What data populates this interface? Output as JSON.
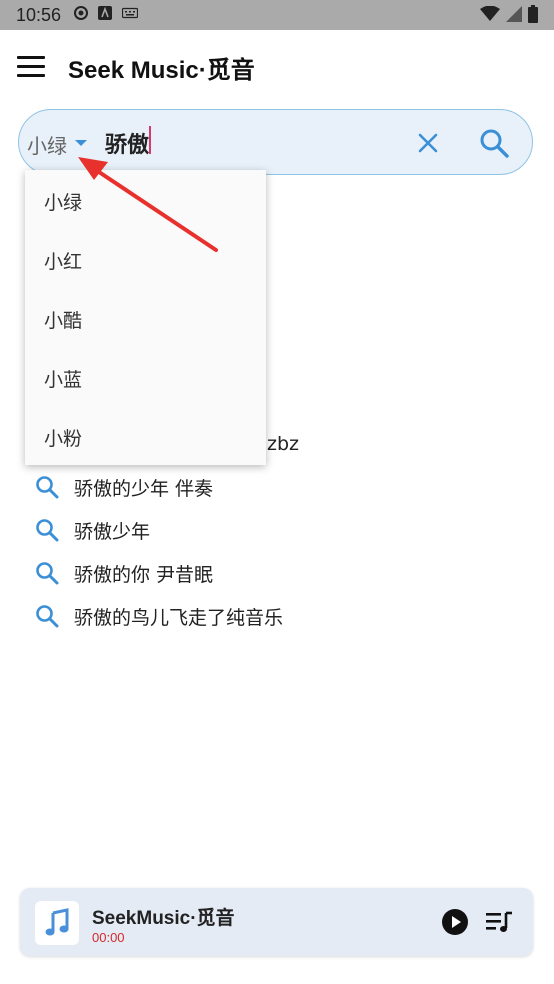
{
  "status_bar": {
    "time": "10:56"
  },
  "app_bar": {
    "title": "Seek Music·觅音"
  },
  "search": {
    "source": "小绿",
    "query": "骄傲"
  },
  "source_dropdown": {
    "items": [
      "小绿",
      "小红",
      "小酷",
      "小蓝",
      "小粉"
    ]
  },
  "suggestions": {
    "partial_visible": "zbz",
    "items": [
      "骄傲的少年 伴奏",
      "骄傲少年",
      "骄傲的你 尹昔眠",
      "骄傲的鸟儿飞走了纯音乐"
    ]
  },
  "player": {
    "title": "SeekMusic·觅音",
    "time": "00:00"
  },
  "colors": {
    "accent": "#3a8fd6",
    "annotation_arrow": "#e8312d",
    "time_red": "#d42a2a"
  },
  "icons": [
    "menu-icon",
    "search-icon",
    "close-icon",
    "dropdown-caret-icon",
    "music-note-icon",
    "play-icon",
    "playlist-icon"
  ]
}
